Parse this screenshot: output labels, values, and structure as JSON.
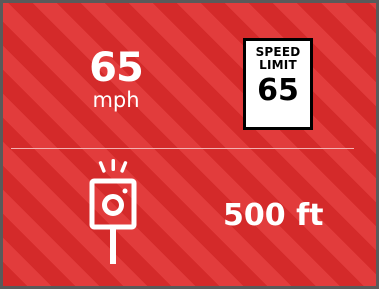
{
  "current_speed": {
    "value": "65",
    "unit": "mph"
  },
  "speed_limit_sign": {
    "title": "SPEED LIMIT",
    "value": "65"
  },
  "speed_camera": {
    "icon": "speed-camera-icon",
    "distance": "500 ft"
  },
  "colors": {
    "alert_background": "#d42a2a",
    "stripe": "#e23c3c",
    "frame": "#5a5a5a",
    "text": "#ffffff",
    "sign_background": "#ffffff",
    "sign_text": "#000000"
  }
}
